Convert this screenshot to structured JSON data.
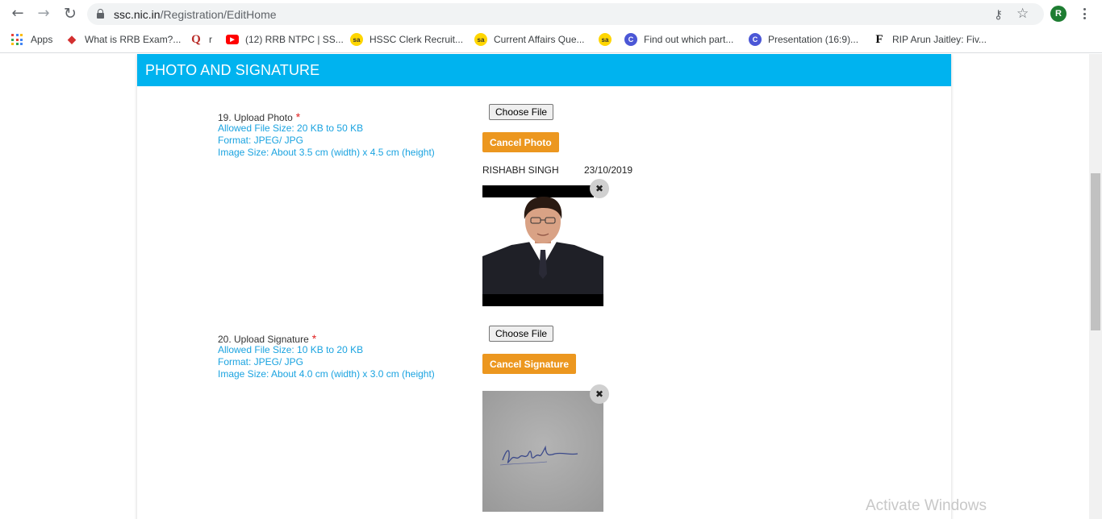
{
  "browser": {
    "url_host": "ssc.nic.in",
    "url_path": "/Registration/EditHome",
    "avatar_letter": "R",
    "icons": [
      "back-arrow-icon",
      "forward-arrow-icon",
      "reload-icon",
      "lock-icon",
      "key-icon",
      "star-icon",
      "kebab-menu-icon"
    ]
  },
  "bookmarks": [
    {
      "label": "Apps",
      "icon": "apps-grid-icon"
    },
    {
      "label": "What is RRB Exam?...",
      "icon": "rrb-icon"
    },
    {
      "label": "r",
      "icon": "quora-icon"
    },
    {
      "label": "(12) RRB NTPC | SS...",
      "icon": "youtube-icon"
    },
    {
      "label": "HSSC Clerk Recruit...",
      "icon": "sa-icon"
    },
    {
      "label": "Current Affairs Que...",
      "icon": "sa-icon"
    },
    {
      "label": "",
      "icon": "sa-icon"
    },
    {
      "label": "Find out which part...",
      "icon": "canva-icon"
    },
    {
      "label": "Presentation (16:9)...",
      "icon": "canva-icon"
    },
    {
      "label": "RIP Arun Jaitley: Fiv...",
      "icon": "f-icon"
    }
  ],
  "section": {
    "title": "PHOTO AND SIGNATURE",
    "header_color": "#00b3ef",
    "accent_color": "#ec971f",
    "hint_color": "#1aa3e0"
  },
  "photo": {
    "label": "19. Upload Photo",
    "required_mark": "*",
    "hint_size": "Allowed File Size: 20 KB to 50 KB",
    "hint_format": "Format: JPEG/ JPG",
    "hint_dimensions": "Image Size: About 3.5 cm (width) x 4.5 cm (height)",
    "choose_label": "Choose File",
    "cancel_label": "Cancel Photo",
    "name": "RISHABH SINGH",
    "date": "23/10/2019",
    "remove_icon": "close-icon"
  },
  "signature": {
    "label": "20. Upload Signature",
    "required_mark": "*",
    "hint_size": "Allowed File Size: 10 KB to 20 KB",
    "hint_format": "Format: JPEG/ JPG",
    "hint_dimensions": "Image Size: About 4.0 cm (width) x 3.0 cm (height)",
    "choose_label": "Choose File",
    "cancel_label": "Cancel Signature",
    "remove_icon": "close-icon"
  },
  "watermark": "Activate Windows"
}
